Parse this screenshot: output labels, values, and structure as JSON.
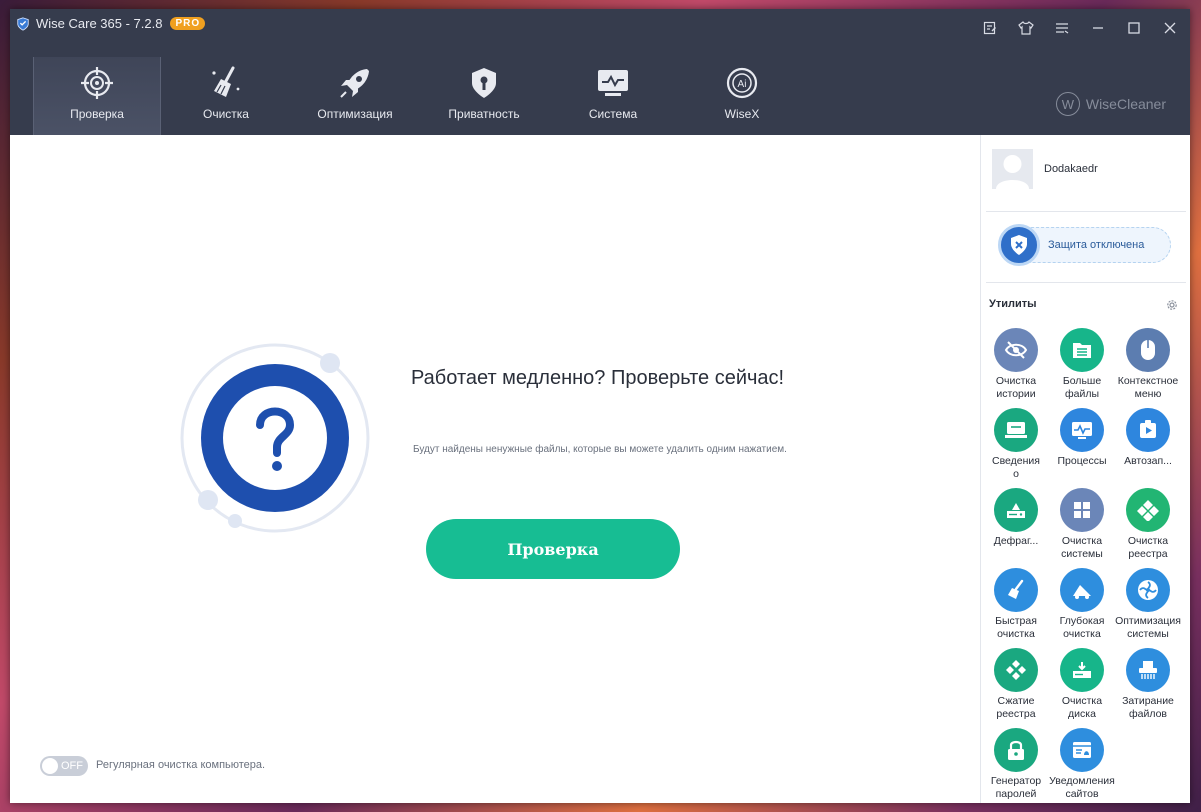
{
  "window": {
    "title": "Wise Care 365 - 7.2.8",
    "badge": "PRO",
    "brand": "WiseCleaner"
  },
  "nav": {
    "tabs": [
      {
        "label": "Проверка",
        "icon": "target-icon"
      },
      {
        "label": "Очистка",
        "icon": "broom-icon"
      },
      {
        "label": "Оптимизация",
        "icon": "rocket-icon"
      },
      {
        "label": "Приватность",
        "icon": "shield-lock-icon"
      },
      {
        "label": "Система",
        "icon": "monitor-icon"
      },
      {
        "label": "WiseX",
        "icon": "ai-icon"
      }
    ],
    "active": "Проверка"
  },
  "main": {
    "headline": "Работает медленно? Проверьте сейчас!",
    "subtitle": "Будут найдены ненужные файлы, которые вы можете удалить одним нажатием.",
    "scan_button": "Проверка",
    "toggle_state": "OFF",
    "toggle_label": "Регулярная очистка компьютера."
  },
  "side": {
    "username": "Dodakaedr",
    "protection": "Защита отключена",
    "utilities_title": "Утилиты",
    "utilities": [
      {
        "label": "Очистка\nистории",
        "color": "#6b86b8"
      },
      {
        "label": "Больше\nфайлы",
        "color": "#17b58a"
      },
      {
        "label": "Контекстное\nменю",
        "color": "#5c7db0"
      },
      {
        "label": "Сведения\nо",
        "color": "#1aa880"
      },
      {
        "label": "Процессы",
        "color": "#2e86de"
      },
      {
        "label": "Автозап...",
        "color": "#2e86de"
      },
      {
        "label": "Дефраг...",
        "color": "#1aa880"
      },
      {
        "label": "Очистка\nсистемы",
        "color": "#6b86b8"
      },
      {
        "label": "Очистка\nреестра",
        "color": "#22b573"
      },
      {
        "label": "Быстрая\nочистка",
        "color": "#2e8ede"
      },
      {
        "label": "Глубокая\nочистка",
        "color": "#2e8ede"
      },
      {
        "label": "Оптимизация\nсистемы",
        "color": "#2e8ede"
      },
      {
        "label": "Сжатие\nреестра",
        "color": "#1aa880"
      },
      {
        "label": "Очистка\nдиска",
        "color": "#17b58a"
      },
      {
        "label": "Затирание\nфайлов",
        "color": "#2e8ede"
      },
      {
        "label": "Генератор\nпаролей",
        "color": "#1aa880"
      },
      {
        "label": "Уведомления\nсайтов",
        "color": "#2e8ede"
      }
    ]
  }
}
